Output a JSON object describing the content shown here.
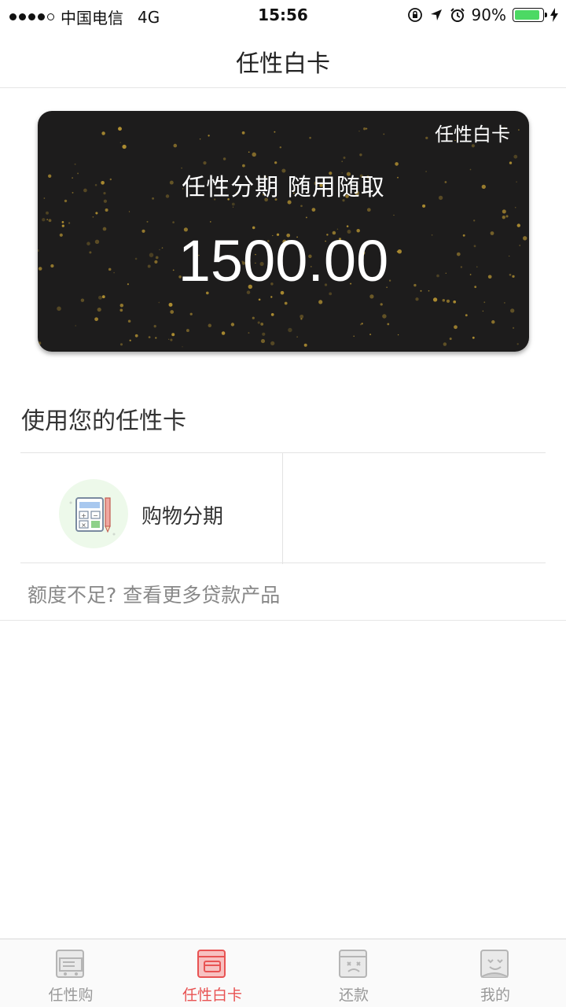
{
  "status_bar": {
    "carrier": "中国电信",
    "network": "4G",
    "time": "15:56",
    "battery": "90%",
    "battery_level": 0.9,
    "icons": [
      "signal-dots-icon",
      "orientation-lock-icon",
      "location-arrow-icon",
      "alarm-icon",
      "battery-icon",
      "charging-bolt-icon"
    ]
  },
  "nav": {
    "title": "任性白卡"
  },
  "card": {
    "label": "任性白卡",
    "slogan": "任性分期  随用随取",
    "amount": "1500.00"
  },
  "section": {
    "title": "使用您的任性卡",
    "items": [
      {
        "label": "购物分期",
        "icon": "calculator-pencil-icon"
      }
    ],
    "more_link": "额度不足? 查看更多贷款产品"
  },
  "tab_bar": {
    "tabs": [
      {
        "label": "任性购",
        "icon": "shopping-cart-icon",
        "active": false
      },
      {
        "label": "任性白卡",
        "icon": "card-icon",
        "active": true
      },
      {
        "label": "还款",
        "icon": "repay-face-icon",
        "active": false
      },
      {
        "label": "我的",
        "icon": "profile-face-icon",
        "active": false
      }
    ]
  },
  "colors": {
    "accent": "#e85353",
    "card_bg": "#1d1c1c",
    "sparkle": "#c9a235",
    "battery_green": "#4cd964",
    "icon_circle": "#edf9ea"
  }
}
